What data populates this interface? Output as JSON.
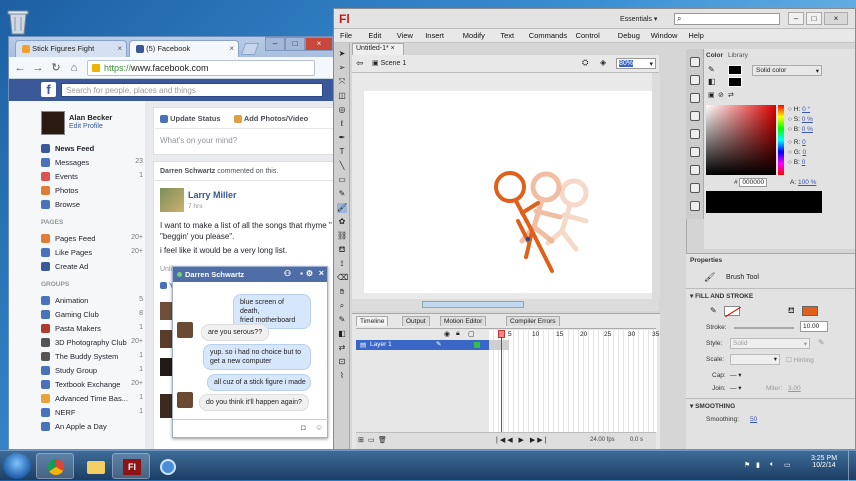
{
  "desktop": {
    "recycle_bin": "trash-icon"
  },
  "chrome": {
    "tabs": [
      {
        "label": "Stick Figures Fight"
      },
      {
        "label": "(5) Facebook"
      }
    ],
    "url_scheme": "https://",
    "url_host": "www.facebook.com",
    "fb_search_placeholder": "Search for people, places and things"
  },
  "fb": {
    "profile": {
      "name": "Alan Becker",
      "edit": "Edit Profile"
    },
    "nav": [
      {
        "label": "News Feed",
        "count": "",
        "color": "#3b5998"
      },
      {
        "label": "Messages",
        "count": "23",
        "color": "#4a72b8"
      },
      {
        "label": "Events",
        "count": "1",
        "color": "#d9534f"
      },
      {
        "label": "Photos",
        "count": "",
        "color": "#e07b39"
      },
      {
        "label": "Browse",
        "count": "",
        "color": "#4a72b8"
      }
    ],
    "pages_header": "PAGES",
    "pages": [
      {
        "label": "Pages Feed",
        "count": "20+",
        "color": "#e07b39"
      },
      {
        "label": "Like Pages",
        "count": "20+",
        "color": "#4a72b8"
      },
      {
        "label": "Create Ad",
        "count": "",
        "color": "#3b5998"
      }
    ],
    "groups_header": "GROUPS",
    "groups": [
      {
        "label": "Animation",
        "count": "5",
        "color": "#4a72b8"
      },
      {
        "label": "Gaming Club",
        "count": "8",
        "color": "#4a72b8"
      },
      {
        "label": "Pasta Makers",
        "count": "1",
        "color": "#b03a2e"
      },
      {
        "label": "3D Photography Club",
        "count": "20+",
        "color": "#555555"
      },
      {
        "label": "The Buddy System",
        "count": "1",
        "color": "#555555"
      },
      {
        "label": "Study Group",
        "count": "1",
        "color": "#4a72b8"
      },
      {
        "label": "Textbook Exchange",
        "count": "20+",
        "color": "#4a72b8"
      },
      {
        "label": "Advanced Time Bas...",
        "count": "1",
        "color": "#e8a23a"
      },
      {
        "label": "NERF",
        "count": "1",
        "color": "#4a72b8"
      },
      {
        "label": "An Apple a Day",
        "count": "",
        "color": "#4a72b8"
      }
    ],
    "composer": {
      "update": "Update Status",
      "photos": "Add Photos/Video",
      "placeholder": "What's on your mind?"
    },
    "story": {
      "actor": "Darren Schwartz",
      "verb": "commented on this.",
      "author": "Larry Miller",
      "time": "7 hrs",
      "line1": "I want to make a list of all the songs that rhyme \"",
      "line2": "\"beggin' you please\".",
      "line3": "i feel like it would be a very long list.",
      "unlike": "Unlik",
      "you": "Yo"
    }
  },
  "chat": {
    "name": "Darren Schwartz",
    "messages": [
      {
        "from": "me",
        "text": "blue screen of death,\nfried motherboard"
      },
      {
        "from": "them",
        "text": "are you serous??"
      },
      {
        "from": "me",
        "text": "yup. so i had no choice but to\nget a new computer"
      },
      {
        "from": "me",
        "text": "all cuz of a stick figure i made"
      },
      {
        "from": "them",
        "text": "do you think it'll happen again?"
      }
    ]
  },
  "flash": {
    "logo": "Fl",
    "workspace": "Essentials",
    "menu": [
      "File",
      "Edit",
      "View",
      "Insert",
      "Modify",
      "Text",
      "Commands",
      "Control",
      "Debug",
      "Window",
      "Help"
    ],
    "doc_tab": "Untitled-1*",
    "scene": "Scene 1",
    "zoom": "80%",
    "timeline_tabs": [
      "Timeline",
      "Output",
      "Motion Editor",
      "Compiler Errors"
    ],
    "layer": "Layer 1",
    "frame_numbers": [
      "5",
      "10",
      "15",
      "20",
      "25",
      "30",
      "35"
    ],
    "fps": "24.00 fps",
    "time": "0.0 s",
    "color_tabs": [
      "Color",
      "Library"
    ],
    "color_type": "Solid color",
    "hsb": [
      {
        "k": "H:",
        "v": "0 °"
      },
      {
        "k": "S:",
        "v": "0 %"
      },
      {
        "k": "B:",
        "v": "0 %"
      }
    ],
    "rgb": [
      {
        "k": "R:",
        "v": "0"
      },
      {
        "k": "G:",
        "v": "0"
      },
      {
        "k": "B:",
        "v": "0"
      }
    ],
    "hex": "000000",
    "alpha_label": "A:",
    "alpha": "100 %",
    "properties_tab": "Properties",
    "tool_name": "Brush Tool",
    "fill_stroke_hdr": "FILL AND STROKE",
    "stroke_label": "Stroke:",
    "stroke_val": "10.00",
    "style_label": "Style:",
    "style_val": "Solid",
    "scale_label": "Scale:",
    "hinting": "Hinting",
    "cap_label": "Cap:",
    "join_label": "Join:",
    "miter_label": "Miter:",
    "miter_val": "3.00",
    "smoothing_hdr": "SMOOTHING",
    "smoothing_label": "Smoothing:",
    "smoothing_val": "50",
    "stroke_color": "#e0601a"
  },
  "taskbar": {
    "time": "3:25 PM",
    "date": "10/2/14"
  }
}
